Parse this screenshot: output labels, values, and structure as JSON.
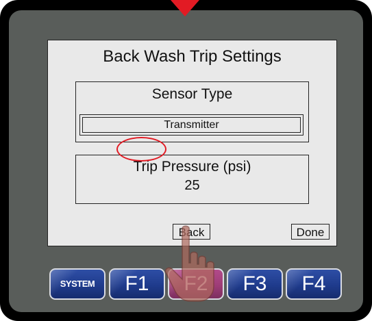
{
  "screen": {
    "title": "Back Wash Trip Settings",
    "sensor_panel": {
      "label": "Sensor Type",
      "value": "Transmitter"
    },
    "trip_panel": {
      "label": "Trip Pressure (psi)",
      "value": "25"
    },
    "buttons": {
      "back": "Back",
      "done": "Done"
    }
  },
  "function_keys": [
    {
      "label": "SYSTEM"
    },
    {
      "label": "F1"
    },
    {
      "label": "F2"
    },
    {
      "label": "F3"
    },
    {
      "label": "F4"
    }
  ],
  "colors": {
    "highlight": "#e21b24",
    "key_blue": "#1f3b8c",
    "key_pressed": "#9e3d77",
    "screen_bg": "#e9e9e9",
    "bezel": "#595d5a"
  },
  "icons": {
    "pointer": "pointer-triangle-icon",
    "hand": "pointing-hand-icon"
  }
}
